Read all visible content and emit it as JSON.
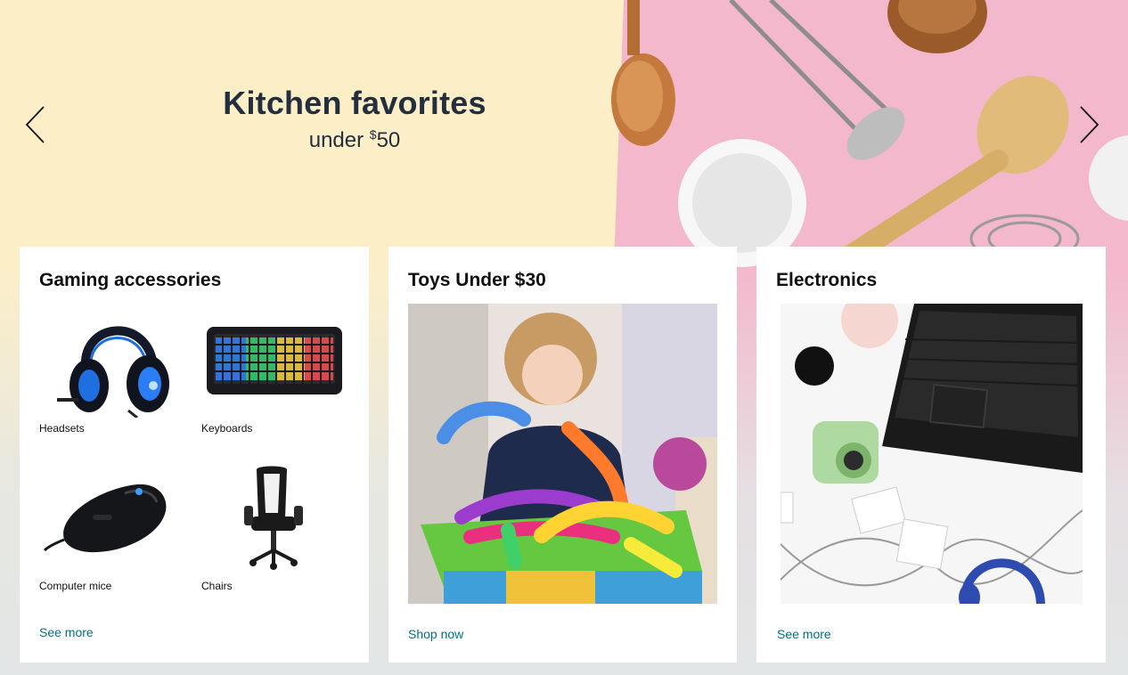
{
  "hero": {
    "title": "Kitchen favorites",
    "subtitle_prefix": "under ",
    "subtitle_currency": "$",
    "subtitle_amount": "50",
    "prev_icon": "chevron-left-icon",
    "next_icon": "chevron-right-icon",
    "colors": {
      "cream": "#fcefc8",
      "pink": "#f4b8cc",
      "text": "#232f3e"
    }
  },
  "cards": [
    {
      "title": "Gaming accessories",
      "items": [
        {
          "label": "Headsets"
        },
        {
          "label": "Keyboards"
        },
        {
          "label": "Computer mice"
        },
        {
          "label": "Chairs"
        }
      ],
      "link": "See more"
    },
    {
      "title": "Toys Under $30",
      "link": "Shop now"
    },
    {
      "title": "Electronics",
      "link": "See more"
    }
  ],
  "colors": {
    "link": "#007185",
    "page_bg": "#e3e6e6",
    "card_bg": "#ffffff"
  }
}
